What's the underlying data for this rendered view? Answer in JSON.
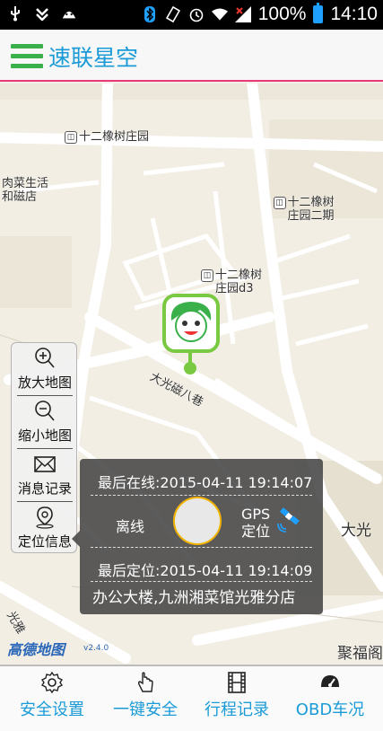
{
  "status_bar": {
    "battery_percent": "100%",
    "time": "14:10",
    "icons": [
      "usb-icon",
      "download-icon",
      "android-icon",
      "bluetooth-icon",
      "vibrate-icon",
      "alarm-icon",
      "wifi-icon",
      "signal-icon",
      "battery-icon"
    ]
  },
  "app_bar": {
    "title": "速联星空",
    "menu_icon": "menu-icon"
  },
  "map": {
    "pois": [
      {
        "label": "十二橡树庄园"
      },
      {
        "label": "肉菜生活\n和磁店"
      },
      {
        "label": "十二橡树\n庄园二期"
      },
      {
        "label": "十二橡树\n庄园d3"
      }
    ],
    "road_labels": [
      "大光磁八巷",
      "大光",
      "聚福阁",
      "光雅"
    ],
    "provider_logo": "高德地图",
    "provider_version": "v2.4.0",
    "colors": {
      "marker": "#7ac943",
      "road": "#ffffff",
      "land": "#f2eee4"
    }
  },
  "tools": {
    "zoom_in": "放大地图",
    "zoom_out": "缩小地图",
    "messages": "消息记录",
    "location": "定位信息"
  },
  "popup": {
    "last_online": "最后在线:2015-04-11 19:14:07",
    "status": "离线",
    "gps_line1": "GPS",
    "gps_line2": "定位",
    "last_located": "最后定位:2015-04-11 19:14:09",
    "address": "办公大楼,九洲湘菜馆光雅分店"
  },
  "bottom_nav": {
    "items": [
      {
        "label": "安全设置",
        "icon": "gear-icon"
      },
      {
        "label": "一键安全",
        "icon": "hand-pointer-icon"
      },
      {
        "label": "行程记录",
        "icon": "film-icon"
      },
      {
        "label": "OBD车况",
        "icon": "speedometer-icon"
      }
    ],
    "accent": "#1a9bd7"
  }
}
